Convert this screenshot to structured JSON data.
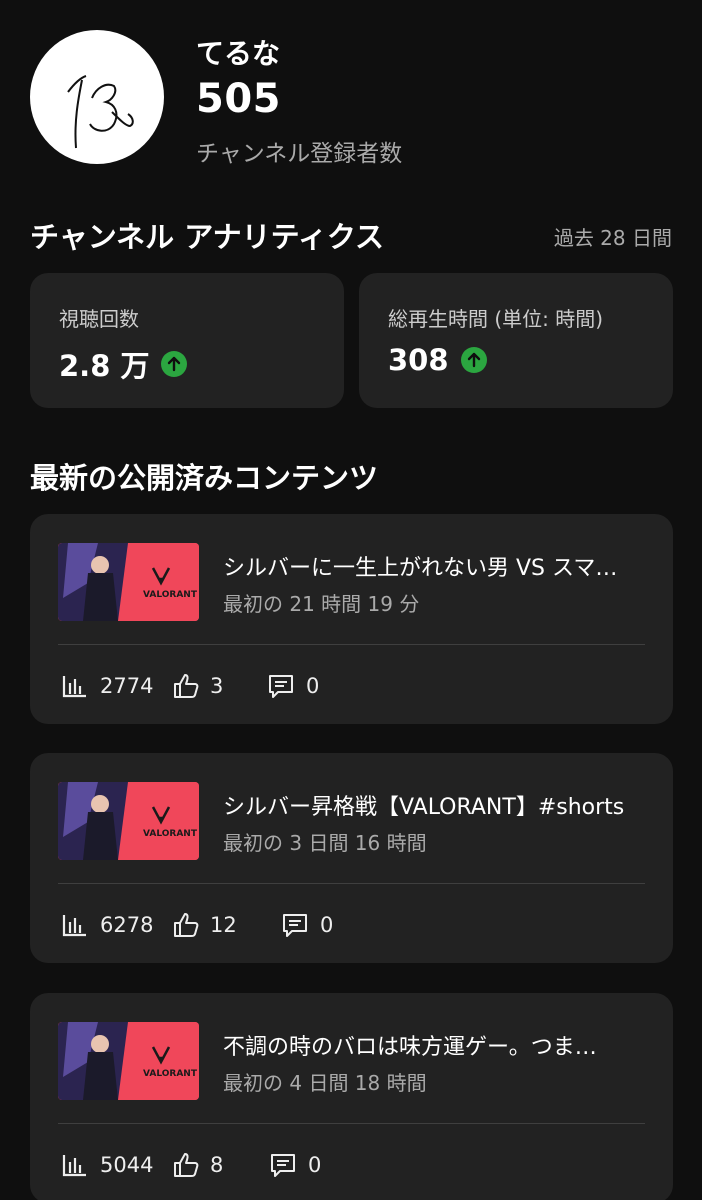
{
  "channel": {
    "name": "てるな",
    "subscriber_count": "505",
    "subscriber_label": "チャンネル登録者数",
    "avatar_signature": "てる"
  },
  "analytics": {
    "title": "チャンネル アナリティクス",
    "period": "過去 28 日間",
    "stats": [
      {
        "label": "視聴回数",
        "value": "2.8 万",
        "trend": "up"
      },
      {
        "label": "総再生時間 (単位: 時間)",
        "value": "308",
        "trend": "up"
      }
    ],
    "trend_color": "#2ba640"
  },
  "latest": {
    "title": "最新の公開済みコンテンツ",
    "videos": [
      {
        "title": "シルバーに一生上がれない男 VS スマ…",
        "age": "最初の 21 時間 19 分",
        "views": "2774",
        "likes": "3",
        "comments": "0",
        "thumb_text": "VALORANT"
      },
      {
        "title": "シルバー昇格戦【VALORANT】#shorts",
        "age": "最初の 3 日間 16 時間",
        "views": "6278",
        "likes": "12",
        "comments": "0",
        "thumb_text": "VALORANT"
      },
      {
        "title": "不調の時のバロは味方運ゲー。つま…",
        "age": "最初の 4 日間 18 時間",
        "views": "5044",
        "likes": "8",
        "comments": "0",
        "thumb_text": "VALORANT"
      }
    ]
  },
  "icons": {
    "trend": "arrow-up-icon",
    "views": "bar-chart-icon",
    "likes": "thumbs-up-icon",
    "comments": "comment-icon"
  }
}
